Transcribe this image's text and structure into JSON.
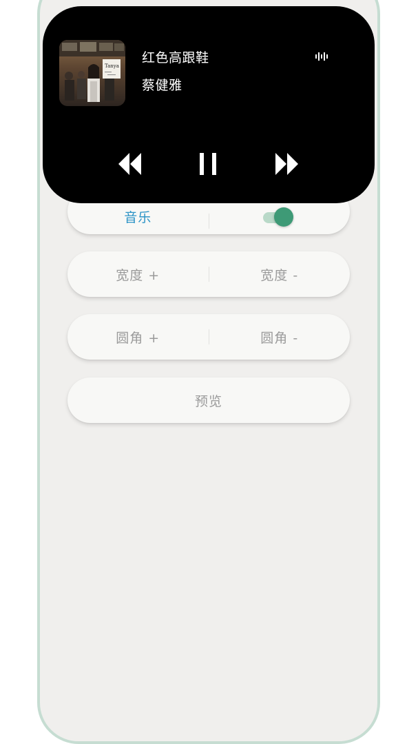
{
  "media": {
    "title": "红色高跟鞋",
    "artist": "蔡健雅",
    "album_art_text": "Tanya"
  },
  "controls": {
    "music_label": "音乐",
    "music_enabled": true,
    "width_plus": "宽度 +",
    "width_minus": "宽度 -",
    "radius_plus": "圆角 +",
    "radius_minus": "圆角 -",
    "preview": "预览"
  },
  "icons": {
    "wave": "sound-wave-icon",
    "prev": "previous-track-icon",
    "pause": "pause-icon",
    "next": "next-track-icon"
  },
  "colors": {
    "accent": "#2b93c6",
    "toggle_on": "#3e9a76",
    "frame_border": "#c6ddd2"
  }
}
